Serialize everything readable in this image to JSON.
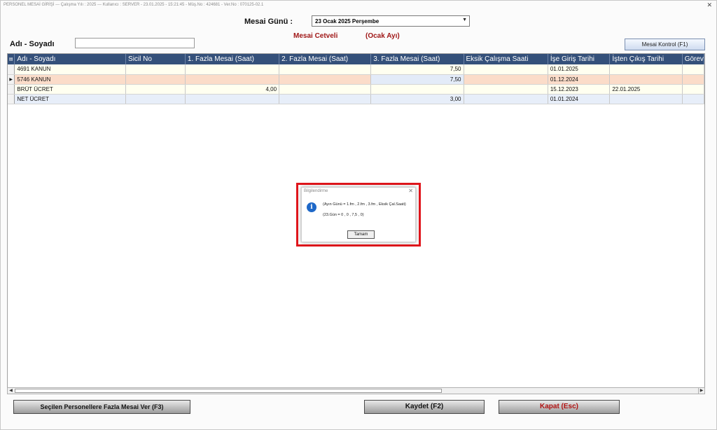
{
  "window": {
    "title": "PERSONEL MESAİ GİRİŞİ  ---  Çalışma Yılı : 2025  ---  Kullanıcı : SERVER - 23.01.2025 - 15:21:45 - Müş.No : 424681 - Ver.No : 070125-02.1",
    "close_glyph": "✕"
  },
  "filter": {
    "date_label": "Mesai Günü :",
    "date_value": "23   Ocak   2025  Perşembe",
    "name_label": "Adı - Soyadı",
    "name_value": ""
  },
  "heading": {
    "cetveli": "Mesai Cetveli",
    "month": "(Ocak Ayı)"
  },
  "kontrol_button": "Mesai Kontrol (F1)",
  "grid": {
    "columns": [
      "Adı - Soyadı",
      "Sicil No",
      "1. Fazla Mesai (Saat)",
      "2. Fazla Mesai (Saat)",
      "3. Fazla Mesai (Saat)",
      "Eksik Çalışma Saati",
      "İşe Giriş Tarihi",
      "İşten Çıkış Tarihi",
      "Görev"
    ],
    "rows": [
      {
        "name": "4691 KANUN",
        "sicil": "",
        "fm1": "",
        "fm2": "",
        "fm3": "7,50",
        "eksik": "",
        "giris": "01.01.2025",
        "cikis": "",
        "gorev": ""
      },
      {
        "name": "5746 KANUN",
        "sicil": "",
        "fm1": "",
        "fm2": "",
        "fm3": "7,50",
        "eksik": "",
        "giris": "01.12.2024",
        "cikis": "",
        "gorev": ""
      },
      {
        "name": "BRÜT ÜCRET",
        "sicil": "",
        "fm1": "4,00",
        "fm2": "",
        "fm3": "",
        "eksik": "",
        "giris": "15.12.2023",
        "cikis": "22.01.2025",
        "gorev": ""
      },
      {
        "name": "NET ÜCRET",
        "sicil": "",
        "fm1": "",
        "fm2": "",
        "fm3": "3,00",
        "eksik": "",
        "giris": "01.01.2024",
        "cikis": "",
        "gorev": ""
      }
    ]
  },
  "buttons": {
    "ver": "Seçilen Personellere Fazla Mesai Ver (F3)",
    "kaydet": "Kaydet (F2)",
    "kapat": "Kapat (Esc)"
  },
  "dialog": {
    "title": "Bilgilendirme",
    "line1": "(Ayın Günü = 1.fm , 2.fm , 3.fm , Eksik Çal.Saati)",
    "line2": "(23.Gün = 0 , 0 , 7,5 , 0)",
    "ok": "Tamam",
    "info_glyph": "i",
    "close_glyph": "✕"
  },
  "colors": {
    "header_bg": "#34507a",
    "accent_red": "#a01818",
    "highlight_frame": "#e0161c",
    "info_blue": "#1e68c8"
  }
}
